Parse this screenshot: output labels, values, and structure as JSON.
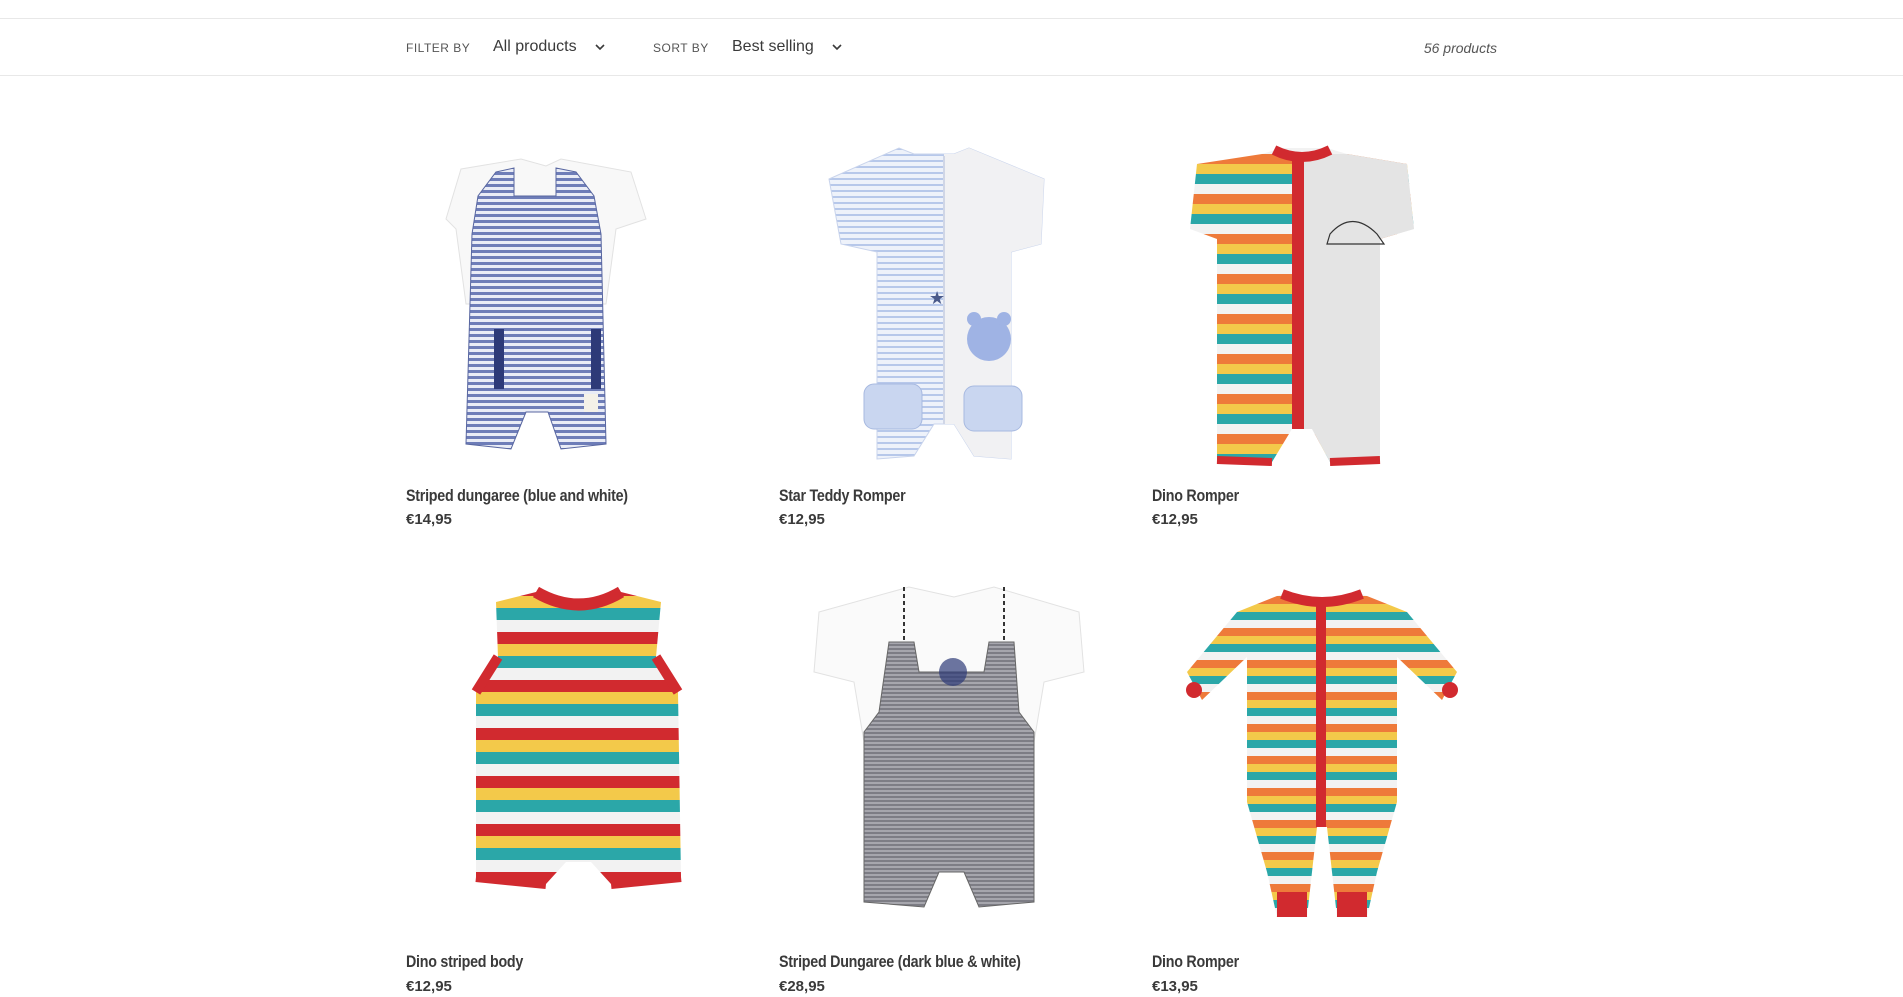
{
  "toolbar": {
    "filter_label": "FILTER BY",
    "filter_value": "All products",
    "sort_label": "SORT BY",
    "sort_value": "Best selling",
    "count": "56 products"
  },
  "products": [
    {
      "title": "Striped dungaree (blue and white)",
      "price": "€14,95",
      "icon": "romper-image"
    },
    {
      "title": "Star Teddy Romper",
      "price": "€12,95",
      "icon": "romper-image"
    },
    {
      "title": "Dino Romper",
      "price": "€12,95",
      "icon": "romper-image"
    },
    {
      "title": "Dino striped body",
      "price": "€12,95",
      "icon": "romper-image"
    },
    {
      "title": "Striped Dungaree (dark blue & white)",
      "price": "€28,95",
      "icon": "romper-image"
    },
    {
      "title": "Dino Romper",
      "price": "€13,95",
      "icon": "romper-image"
    }
  ],
  "colors": {
    "navy_stripe": "#5a6aa8",
    "light_blue": "#cfdcf2",
    "red": "#d12a2f",
    "yellow": "#f3c94a",
    "teal": "#2ba7a8",
    "orange": "#ee7a3a",
    "grey": "#8d8d95"
  }
}
